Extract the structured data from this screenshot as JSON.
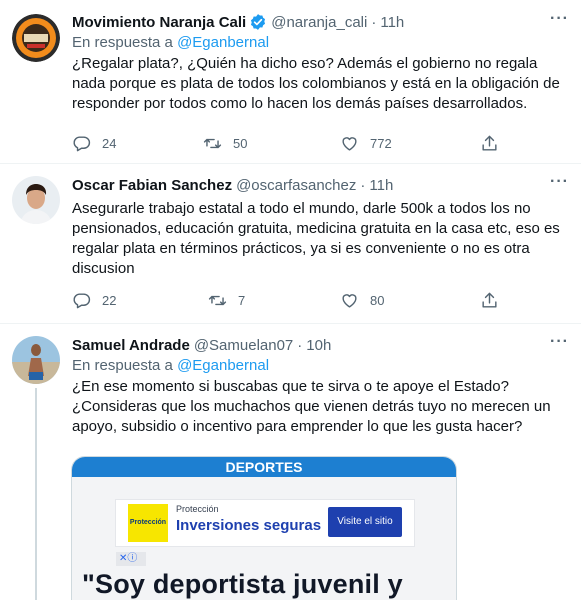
{
  "tweets": [
    {
      "name": "Movimiento Naranja Cali",
      "handle": "@naranja_cali",
      "time": "11h",
      "verified": true,
      "reply_prefix": "En respuesta a",
      "reply_mention": "@Eganbernal",
      "text": "¿Regalar plata?, ¿Quién ha dicho eso? Además el gobierno no regala nada porque es plata de todos los colombianos y está en la obligación de responder por todos como lo hacen los demás países desarrollados.",
      "replies": "24",
      "retweets": "50",
      "likes": "772"
    },
    {
      "name": "Oscar Fabian Sanchez",
      "handle": "@oscarfasanchez",
      "time": "11h",
      "text": "Asegurarle trabajo estatal a todo el mundo, darle 500k a todos los no pensionados, educación gratuita, medicina gratuita en la casa etc, eso es regalar plata en términos prácticos, ya si es conveniente o no  es otra discusion",
      "replies": "22",
      "retweets": "7",
      "likes": "80"
    },
    {
      "name": "Samuel Andrade",
      "handle": "@Samuelan07",
      "time": "10h",
      "reply_prefix": "En respuesta a",
      "reply_mention": "@Eganbernal",
      "text": "¿En ese momento si buscabas que te sirva o te apoye el Estado? ¿Consideras que los muchachos que vienen detrás tuyo no merecen un apoyo, subsidio o incentivo para emprender lo que les gusta hacer?"
    }
  ],
  "media": {
    "section_label": "DEPORTES",
    "ad_logo": "Protección",
    "ad_small": "Protección",
    "ad_big": "Inversiones seguras",
    "ad_button": "Visite el sitio",
    "ad_close": "✕ⓘ",
    "headline": "\"Soy deportista juvenil y"
  },
  "colors": {
    "text": "#0f1419",
    "secondary": "#536471",
    "accent": "#1d9bf0",
    "divider": "#eff3f4"
  },
  "icons": [
    "reply-icon",
    "retweet-icon",
    "like-icon",
    "share-icon",
    "more-icon",
    "verified-badge-icon"
  ]
}
